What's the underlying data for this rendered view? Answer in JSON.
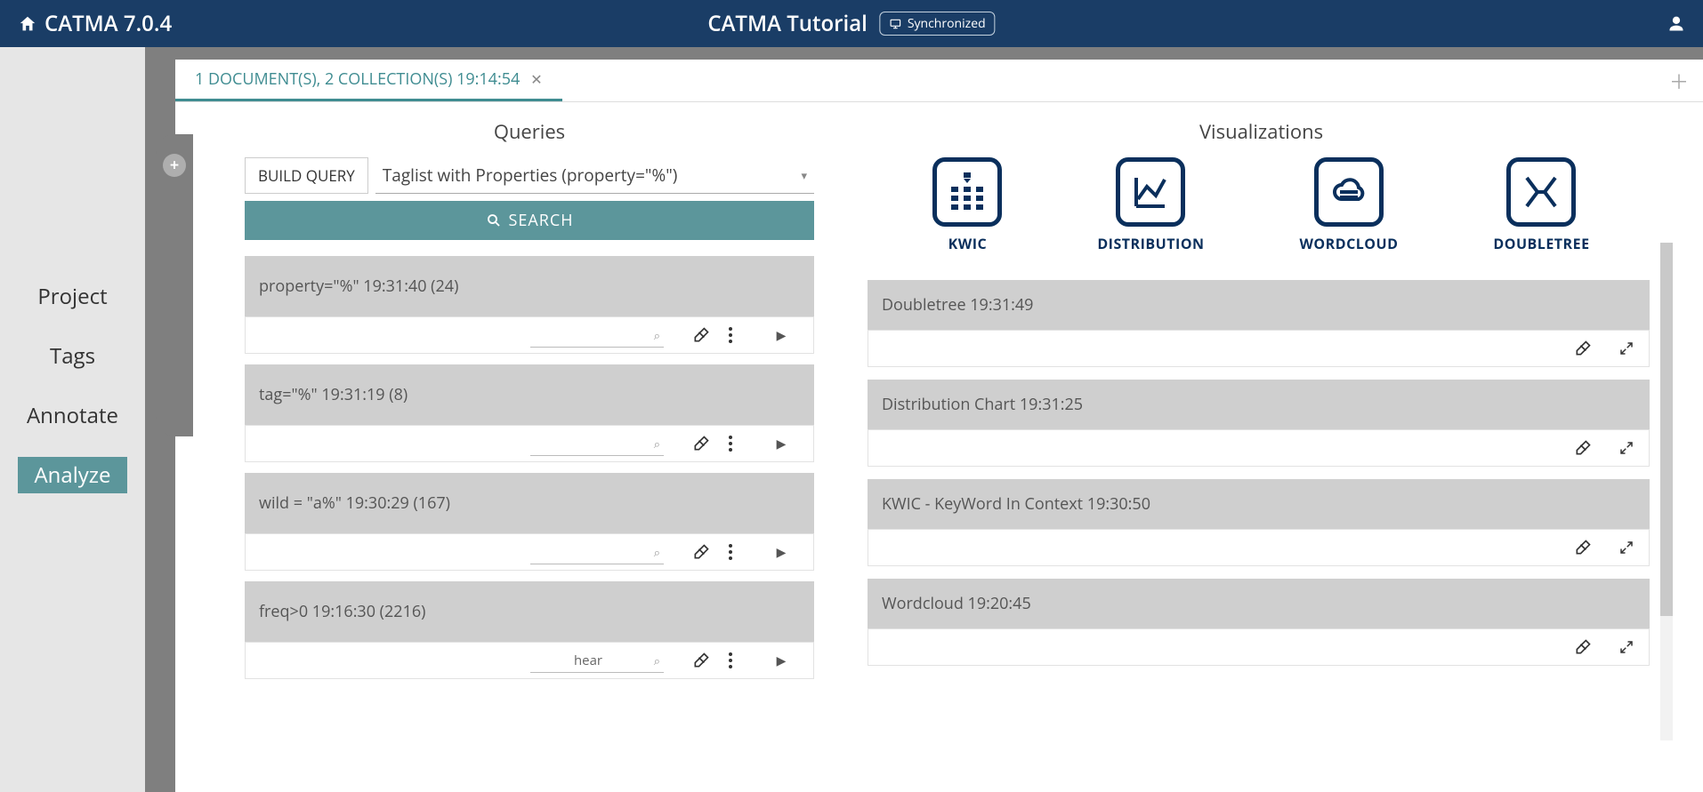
{
  "header": {
    "app_title": "CATMA 7.0.4",
    "project_title": "CATMA Tutorial",
    "sync_label": "Synchronized"
  },
  "sidebar": {
    "items": [
      {
        "label": "Project",
        "active": false
      },
      {
        "label": "Tags",
        "active": false
      },
      {
        "label": "Annotate",
        "active": false
      },
      {
        "label": "Analyze",
        "active": true
      }
    ]
  },
  "tab": {
    "label": "1 DOCUMENT(S), 2 COLLECTION(S) 19:14:54"
  },
  "queries": {
    "heading": "Queries",
    "build_query_label": "BUILD QUERY",
    "select_value": "Taglist with Properties (property=\"%\")",
    "search_label": "SEARCH",
    "results": [
      {
        "title": "property=\"%\" 19:31:40 (24)",
        "filter": ""
      },
      {
        "title": "tag=\"%\" 19:31:19 (8)",
        "filter": ""
      },
      {
        "title": "wild = \"a%\" 19:30:29 (167)",
        "filter": ""
      },
      {
        "title": "freq>0 19:16:30 (2216)",
        "filter": "hear"
      }
    ]
  },
  "visualizations": {
    "heading": "Visualizations",
    "types": [
      {
        "key": "kwic",
        "label": "KWIC"
      },
      {
        "key": "distribution",
        "label": "DISTRIBUTION"
      },
      {
        "key": "wordcloud",
        "label": "WORDCLOUD"
      },
      {
        "key": "doubletree",
        "label": "DOUBLETREE"
      }
    ],
    "cards": [
      {
        "title": "Doubletree 19:31:49"
      },
      {
        "title": "Distribution Chart 19:31:25"
      },
      {
        "title": "KWIC - KeyWord In Context 19:30:50"
      },
      {
        "title": "Wordcloud 19:20:45"
      }
    ]
  }
}
